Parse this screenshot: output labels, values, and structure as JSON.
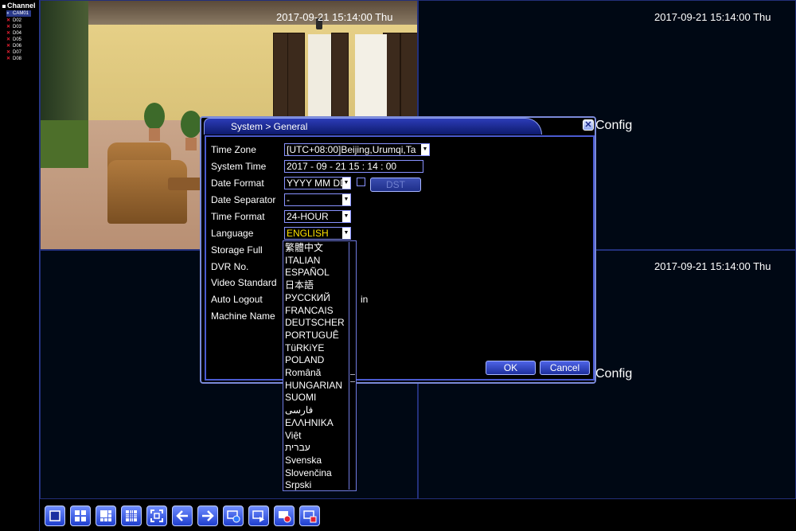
{
  "channel_panel": {
    "title": "Channel",
    "channels": [
      {
        "mark": "●",
        "label": "CAM01",
        "state": "active"
      },
      {
        "mark": "✕",
        "label": "D02",
        "state": "off"
      },
      {
        "mark": "✕",
        "label": "D03",
        "state": "off"
      },
      {
        "mark": "✕",
        "label": "D04",
        "state": "off"
      },
      {
        "mark": "✕",
        "label": "D05",
        "state": "off"
      },
      {
        "mark": "✕",
        "label": "D06",
        "state": "off"
      },
      {
        "mark": "✕",
        "label": "D07",
        "state": "off"
      },
      {
        "mark": "✕",
        "label": "D08",
        "state": "off"
      }
    ]
  },
  "panes": {
    "timestamp_1": "2017-09-21   15:14:00 Thu",
    "timestamp_2": "2017-09-21   15:14:00 Thu",
    "timestamp_4": "2017-09-21   15:14:00 Thu",
    "config_text_1": "Config",
    "config_text_2": "Config"
  },
  "dialog": {
    "title": "System > General",
    "close_label": "✕",
    "labels": {
      "time_zone": "Time Zone",
      "system_time": "System Time",
      "date_format": "Date Format",
      "date_separator": "Date Separator",
      "time_format": "Time Format",
      "language": "Language",
      "storage_full": "Storage Full",
      "dvr_no": "DVR No.",
      "video_standard": "Video Standard",
      "auto_logout": "Auto Logout",
      "machine_name": "Machine Name"
    },
    "values": {
      "time_zone": "[UTC+08:00]Beijing,Urumqi,Ta",
      "system_time": "2017 - 09 - 21    15 : 14 : 00",
      "date_format": "YYYY MM DD",
      "date_separator": "-",
      "time_format": "24-HOUR",
      "language": "ENGLISH",
      "auto_logout_suffix": "in"
    },
    "dst_label": "DST",
    "ok_label": "OK",
    "cancel_label": "Cancel"
  },
  "language_list": {
    "options": [
      "繁體中文",
      "ITALIAN",
      "ESPAÑOL",
      "日本語",
      "РУССКИЙ",
      "FRANCAIS",
      "DEUTSCHER",
      "PORTUGUÊ",
      "TüRKiYE",
      "POLAND",
      "Română",
      "HUNGARIAN",
      "SUOMI",
      "فارسی",
      "ΕΛΛΗΝΙΚΑ",
      "Việt",
      "עברית",
      "Svenska",
      "Slovenčina",
      "Srpski"
    ]
  },
  "toolbar": {
    "buttons": [
      "main-menu-icon",
      "quad-view-icon",
      "nine-view-icon",
      "sixteen-view-icon",
      "fullscreen-icon",
      "prev-arrow-icon",
      "next-arrow-icon",
      "record-icon",
      "playback-icon",
      "video-playback-icon",
      "stop-record-icon"
    ]
  },
  "colors": {
    "accent_blue": "#2238c8",
    "border_blue": "#8892ff",
    "language_value": "#ffe100",
    "offline_red": "#e22233"
  }
}
